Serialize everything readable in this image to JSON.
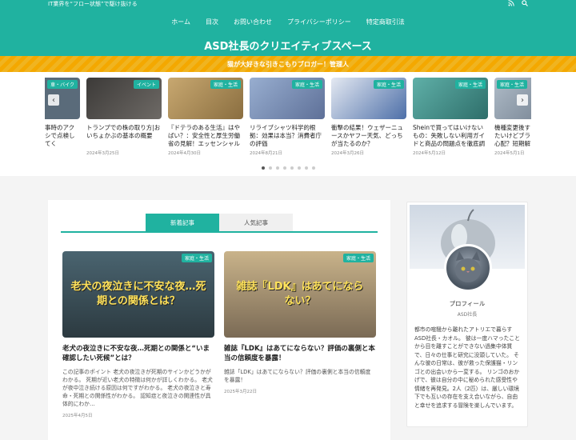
{
  "topbar": {
    "tagline": "IT業界を“フロー状態”で駆け抜ける",
    "icons": [
      "rss-icon",
      "search-icon"
    ]
  },
  "nav": [
    "ホーム",
    "目次",
    "お問い合わせ",
    "プライバシーポリシー",
    "特定商取引法"
  ],
  "site": {
    "title": "ASD社長のクリエイティブスペース",
    "subtitle": "猫が大好きな引きこもりブロガー！管理人"
  },
  "carousel": {
    "cards": [
      {
        "badge": "車・バイク",
        "title": "事時のアクシで点検してく",
        "date": "",
        "bg": "#5a6b7a"
      },
      {
        "badge": "イベント",
        "title": "トランプでの株の取り方|おいちょかぶの基本の概要",
        "date": "2024年3月25日",
        "bg": "#3c3a38"
      },
      {
        "badge": "家庭・生活",
        "title": "『ドテラのある生活』はやばい？：安全性と厚生労働省の見解！エッセンシャル",
        "date": "2024年4月30日",
        "bg": "#b89a60"
      },
      {
        "badge": "家庭・生活",
        "title": "リライブシャツ科学的根拠：効果は本当？消費者庁の評価",
        "date": "2024年8月21日",
        "bg": "#7f94b8"
      },
      {
        "badge": "家庭・生活",
        "title": "衝撃の結果！ウェザーニュースかヤフー天気、どっちが当たるのか？",
        "date": "2024年3月26日",
        "bg": "#4d6fa8"
      },
      {
        "badge": "家庭・生活",
        "title": "Sheinで買ってはいけないもの：失敗しない利用ガイドと商品の問題点を徹底調",
        "date": "2024年5月12日",
        "bg": "#3e8e88"
      },
      {
        "badge": "家庭・生活",
        "title": "機種変更後すたいけどブラ心配？短期解",
        "date": "2024年5月1日",
        "bg": "#8a9aa8"
      }
    ],
    "dots": 8,
    "active_dot": 0
  },
  "tabs": {
    "new": "新着記事",
    "popular": "人気記事"
  },
  "articles": [
    {
      "badge": "家庭・生活",
      "thumb_text": "老犬の夜泣きに不安な夜…死期との関係とは？",
      "title": "老犬の夜泣きに不安な夜…死期との関係と“いま確認したい死候”とは？",
      "excerpt": "この記事のポイント 老犬の夜泣きが死期のサインかどうかがわかる。 死期が近い老犬の特徴は何かが詳しくわかる。 老犬が夜中泣き続ける原因は何ですがわかる。 老犬の夜泣きと寿命・死期との関係性がわかる。 認知症と夜泣きの関連性が具体的にわか…",
      "date": "2025年4月5日"
    },
    {
      "badge": "家庭・生活",
      "thumb_text": "雑誌『LDK』はあてにならない？",
      "title": "雑誌『LDK』はあてにならない？評価の裏側と本当の信頼度を暴露！",
      "excerpt": "雑誌「LDK」はあてにならない？評価の裏側と本当の信頼度を暴露！",
      "date": "2025年3月22日"
    }
  ],
  "profile": {
    "label": "プロフィール",
    "name": "ASD社長",
    "bio": "都市の喧騒から離れたアトリエで暮らすASD社長・カオル。 彼は一度ハマったことから目を離すことができない過集中体質で、日々の仕事と研究に没頭していた。 そんな彼の日常は、彼が救った保護猫・リンゴとの出会いから一変する。 リンゴのおかげで、彼は自分の中に秘められた感受性や情緒を再発見。2人（2匹）は、厳しい環境下でも互いの存在を支え合いながら、自由と幸せを追求する冒険を楽しんでいます。"
  }
}
